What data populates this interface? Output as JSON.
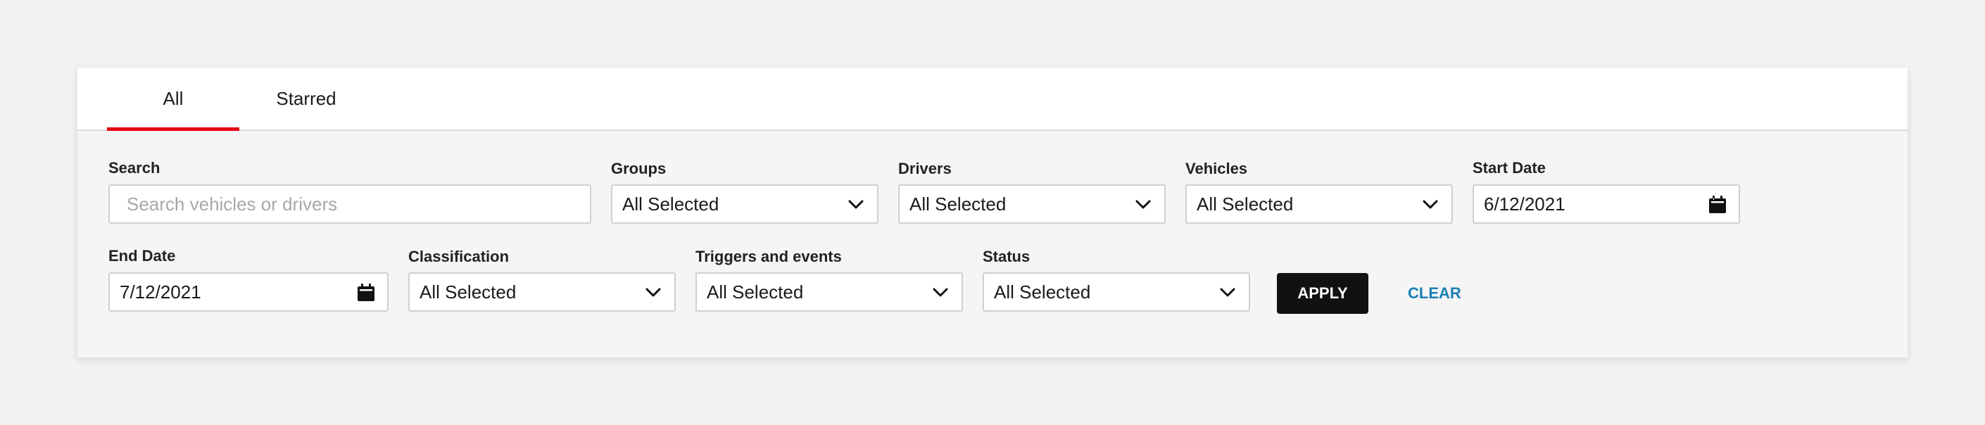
{
  "tabs": [
    {
      "label": "All",
      "active": true
    },
    {
      "label": "Starred",
      "active": false
    }
  ],
  "filters": {
    "search": {
      "label": "Search",
      "placeholder": "Search vehicles or drivers",
      "value": ""
    },
    "groups": {
      "label": "Groups",
      "value": "All Selected"
    },
    "drivers": {
      "label": "Drivers",
      "value": "All Selected"
    },
    "vehicles": {
      "label": "Vehicles",
      "value": "All Selected"
    },
    "start_date": {
      "label": "Start Date",
      "value": "6/12/2021"
    },
    "end_date": {
      "label": "End Date",
      "value": "7/12/2021"
    },
    "classification": {
      "label": "Classification",
      "value": "All Selected"
    },
    "triggers": {
      "label": "Triggers and events",
      "value": "All Selected"
    },
    "status": {
      "label": "Status",
      "value": "All Selected"
    }
  },
  "actions": {
    "apply_label": "APPLY",
    "clear_label": "CLEAR"
  },
  "colors": {
    "active_tab_indicator": "#e60012",
    "apply_background": "#111111",
    "clear_link": "#1a7fb5"
  }
}
